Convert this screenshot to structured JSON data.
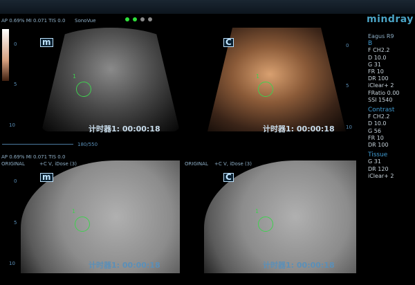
{
  "header": {
    "status_line": "AP 0.69%  MI 0.071 TIS 0.0",
    "agent": "SonoVue",
    "indicator_dots": [
      "#2fe03a",
      "#2fe03a",
      "#888888",
      "#888888"
    ]
  },
  "brand": "mindray",
  "params": {
    "preset": "Eagus R9",
    "b_title": "B",
    "b": [
      "F CH2.2",
      "D 10.0",
      "G 31",
      "FR 10",
      "DR 100",
      "iClear+ 2",
      "FRatio 0.00",
      "SSI 1540"
    ],
    "contrast_title": "Contrast",
    "contrast": [
      "F CH2.2",
      "D 10.0",
      "G 56",
      "FR 10",
      "DR 100"
    ],
    "tissue_title": "Tissue",
    "tissue": [
      "G 31",
      "DR 120",
      "iClear+ 2"
    ]
  },
  "panels": {
    "bmode_tag": "m",
    "contrast_tag": "C",
    "roi_marker": "1",
    "timer": "计时器1: 00:00:18",
    "depth_ticks": [
      "0",
      "5",
      "10"
    ],
    "cine": "180/550",
    "fusion_status": "AP 0.69%  MI 0.071 TIS 0.0",
    "original": "ORIGINAL",
    "ct_label": "+C V, iDose (3)"
  }
}
